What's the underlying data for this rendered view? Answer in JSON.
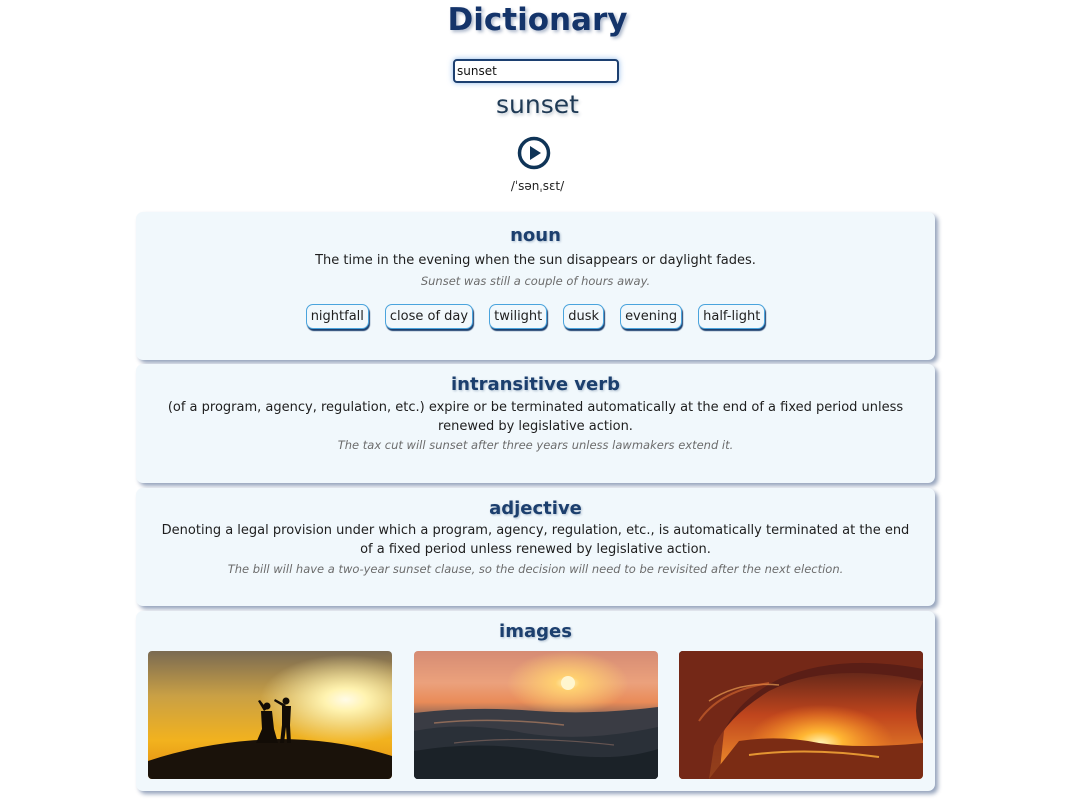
{
  "app": {
    "title": "Dictionary"
  },
  "search": {
    "value": "sunset"
  },
  "word": "sunset",
  "phonetic": "/ˈsənˌsɛt/",
  "meanings": [
    {
      "part_of_speech": "noun",
      "definition": "The time in the evening when the sun disappears or daylight fades.",
      "example": "Sunset was still a couple of hours away.",
      "synonyms": [
        "nightfall",
        "close of day",
        "twilight",
        "dusk",
        "evening",
        "half-light"
      ]
    },
    {
      "part_of_speech": "intransitive verb",
      "definition": "(of a program, agency, regulation, etc.) expire or be terminated automatically at the end of a fixed period unless renewed by legislative action.",
      "example": "The tax cut will sunset after three years unless lawmakers extend it."
    },
    {
      "part_of_speech": "adjective",
      "definition": "Denoting a legal provision under which a program, agency, regulation, etc., is automatically terminated at the end of a fixed period unless renewed by legislative action.",
      "example": "The bill will have a two-year sunset clause, so the decision will need to be revisited after the next election."
    }
  ],
  "images_section": {
    "heading": "images",
    "photos": [
      "couple-silhouette-sunset",
      "ocean-waves-sunset",
      "wave-curl-sunset"
    ]
  },
  "colors": {
    "title": "#14346a",
    "card_background": "#f1f8fc",
    "synonym_border": "#4aa4dd",
    "heading": "#1c3f6e"
  },
  "icons": {
    "play": "play-circle-icon"
  }
}
